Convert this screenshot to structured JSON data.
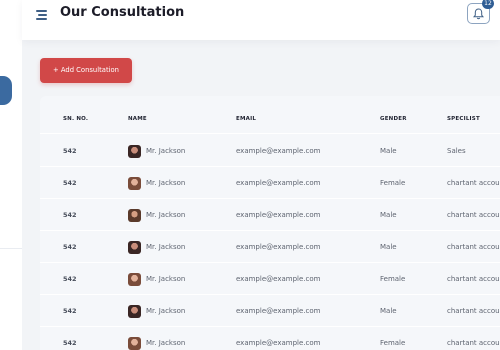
{
  "header": {
    "title": "Our Consultation",
    "notification_count": "12"
  },
  "actions": {
    "add_label": "+ Add Consultation"
  },
  "table": {
    "columns": [
      "SN. NO.",
      "NAME",
      "EMAIL",
      "GENDER",
      "SPECILIST"
    ],
    "rows": [
      {
        "sn": "542",
        "name": "Mr. Jackson",
        "email": "example@example.com",
        "gender": "Male",
        "specialist": "Sales"
      },
      {
        "sn": "542",
        "name": "Mr. Jackson",
        "email": "example@example.com",
        "gender": "Female",
        "specialist": "chartant accou"
      },
      {
        "sn": "542",
        "name": "Mr. Jackson",
        "email": "example@example.com",
        "gender": "Male",
        "specialist": "chartant accou"
      },
      {
        "sn": "542",
        "name": "Mr. Jackson",
        "email": "example@example.com",
        "gender": "Male",
        "specialist": "chartant accou"
      },
      {
        "sn": "542",
        "name": "Mr. Jackson",
        "email": "example@example.com",
        "gender": "Female",
        "specialist": "chartant accou"
      },
      {
        "sn": "542",
        "name": "Mr. Jackson",
        "email": "example@example.com",
        "gender": "Male",
        "specialist": "chartant accou"
      },
      {
        "sn": "542",
        "name": "Mr. Jackson",
        "email": "example@example.com",
        "gender": "Female",
        "specialist": "chartant accou"
      }
    ]
  },
  "icons": {
    "menu": "hamburger-menu-icon",
    "notifications": "bell-icon"
  },
  "colors": {
    "accent": "#d14848",
    "brand": "#2f5d94",
    "background": "#f2f4f7"
  }
}
